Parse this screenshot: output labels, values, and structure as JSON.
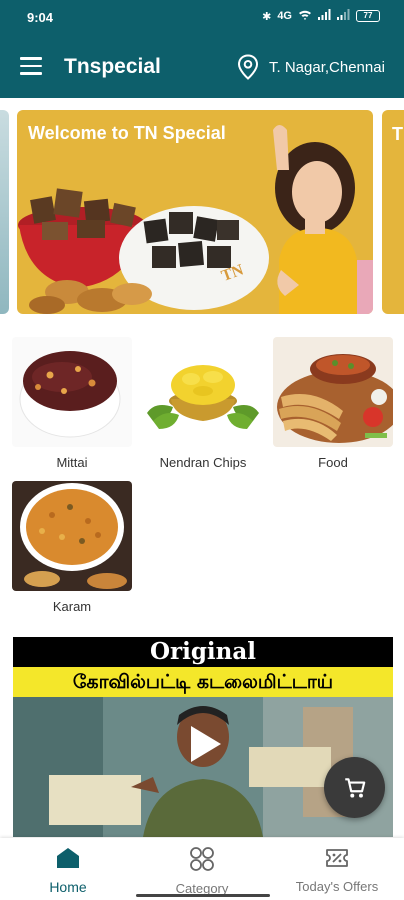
{
  "status_bar": {
    "time": "9:04",
    "battery": "77",
    "network": "4G"
  },
  "app_bar": {
    "title": "Tnspecial",
    "location": "T. Nagar,Chennai"
  },
  "banner": {
    "title": "Welcome to TN Special",
    "next_peek_text": "T"
  },
  "categories": [
    {
      "label": "Mittai"
    },
    {
      "label": "Nendran Chips"
    },
    {
      "label": "Food"
    },
    {
      "label": "Karam"
    }
  ],
  "video": {
    "line1": "Original",
    "line2": "கோவில்பட்டி கடலைமிட்டாய்"
  },
  "bottom_nav": {
    "items": [
      {
        "label": "Home",
        "icon": "home-icon",
        "active": true
      },
      {
        "label": "Category",
        "icon": "grid-icon",
        "active": false
      },
      {
        "label": "Today's Offers",
        "icon": "offer-tag-icon",
        "active": false
      }
    ]
  },
  "colors": {
    "primary": "#0d5f6b",
    "banner_bg": "#e4b53c",
    "fab_bg": "#3a3a3a"
  }
}
